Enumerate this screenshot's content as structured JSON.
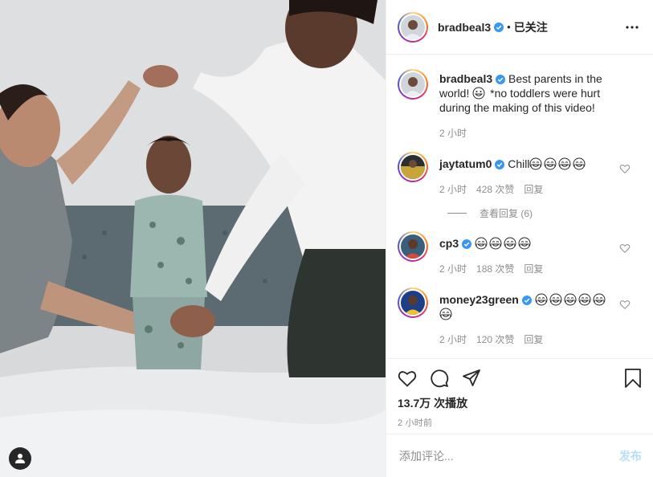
{
  "post": {
    "author": "bradbeal3",
    "follow_status": "已关注",
    "separator": "•"
  },
  "caption": {
    "username": "bradbeal3",
    "text_before_emoji": "Best parents in the world!",
    "emoji": "grinning-face",
    "text_after_emoji": "*no toddlers were hurt during the making of this video!",
    "time": "2 小时"
  },
  "comments": [
    {
      "username": "jaytatum0",
      "verified": true,
      "text": "Chill",
      "emojis": [
        "tears-of-joy",
        "tears-of-joy",
        "tears-of-joy",
        "tears-of-joy"
      ],
      "time": "2 小时",
      "likes": "428 次赞",
      "reply": "回复",
      "view_replies": "查看回复 (6)"
    },
    {
      "username": "cp3",
      "verified": true,
      "text": "",
      "emojis": [
        "tears-of-joy",
        "tears-of-joy",
        "tears-of-joy",
        "tears-of-joy"
      ],
      "time": "2 小时",
      "likes": "188 次赞",
      "reply": "回复"
    },
    {
      "username": "money23green",
      "verified": true,
      "text": "",
      "emojis": [
        "tears-of-joy",
        "tears-of-joy",
        "tears-of-joy",
        "tears-of-joy",
        "tears-of-joy",
        "tears-of-joy"
      ],
      "time": "2 小时",
      "likes": "120 次赞",
      "reply": "回复"
    }
  ],
  "stats": {
    "views": "13.7万 次播放",
    "posted": "2 小时前"
  },
  "add_comment": {
    "placeholder": "添加评论...",
    "post_label": "发布"
  },
  "icons": {
    "like": "heart-icon",
    "comment": "comment-bubble-icon",
    "share": "paper-plane-icon",
    "save": "bookmark-icon",
    "more": "more-options-icon",
    "verified": "verified-badge-icon",
    "user_tags": "user-tag-icon"
  },
  "colors": {
    "verified_blue": "#3897f0",
    "post_button_disabled": "#b2dffc",
    "secondary_text": "#8e8e8e",
    "border": "#efefef"
  }
}
